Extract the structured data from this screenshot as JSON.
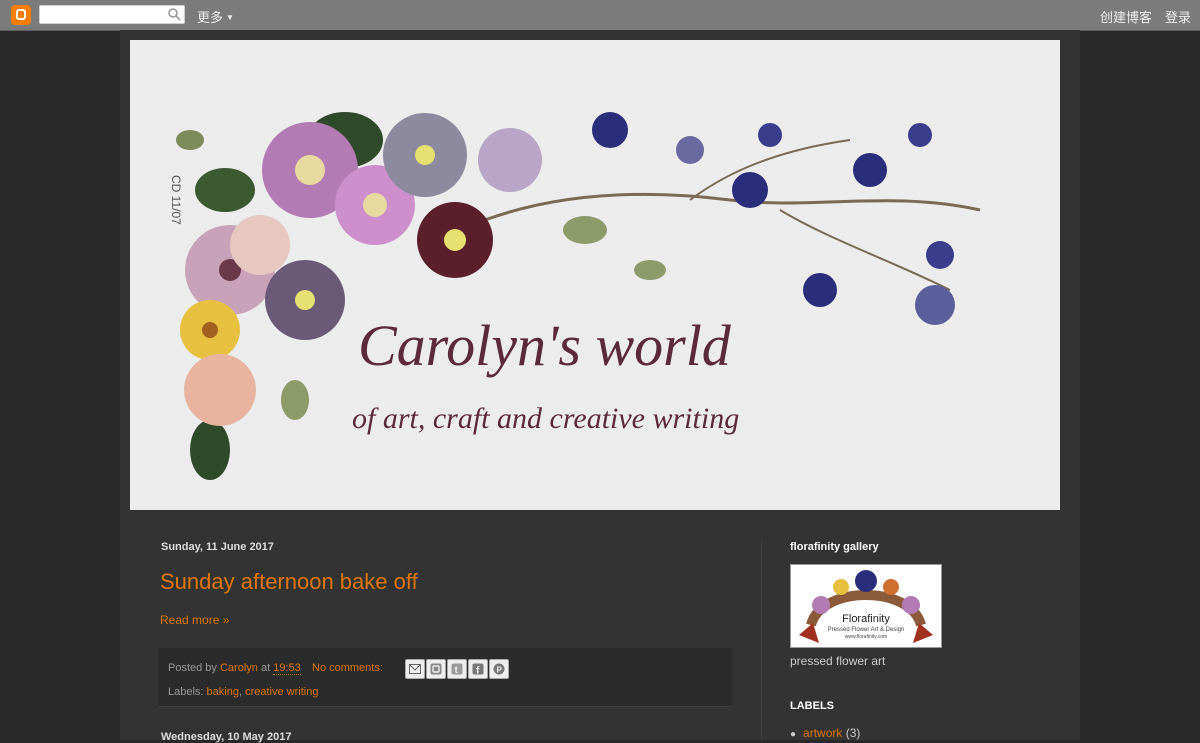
{
  "navbar": {
    "more": "更多",
    "create_blog": "创建博客",
    "sign_in": "登录"
  },
  "header": {
    "title": "Carolyn's world",
    "subtitle": "of art, craft and creative writing",
    "side_note": "CD 11/07"
  },
  "posts": [
    {
      "date": "Sunday, 11 June 2017",
      "title": "Sunday afternoon bake off",
      "read_more": "Read more »",
      "posted_by_prefix": "Posted by",
      "author": "Carolyn",
      "at": "at",
      "time": "19:53",
      "comments": "No comments:",
      "labels_prefix": "Labels:",
      "labels": [
        "baking",
        "creative writing"
      ],
      "label_sep": ", "
    },
    {
      "date": "Wednesday, 10 May 2017"
    }
  ],
  "sidebar": {
    "gallery_title": "florafinity gallery",
    "gallery_logo_title": "Florafinity",
    "gallery_logo_sub": "Pressed Flower Art & Design",
    "gallery_logo_url": "www.florafinity.com",
    "gallery_caption": "pressed flower art",
    "labels_title": "LABELS",
    "labels": [
      {
        "name": "artwork",
        "count": "(3)"
      }
    ]
  },
  "colors": {
    "accent": "#dd7700",
    "background": "#292929",
    "content": "#333333",
    "navbar": "#7b7b7b",
    "blogger_orange": "#f57d00"
  },
  "icons": [
    "blogger-logo-icon",
    "search-icon",
    "chevron-down-icon",
    "email-icon",
    "blogger-icon",
    "twitter-icon",
    "facebook-icon",
    "pinterest-icon"
  ]
}
